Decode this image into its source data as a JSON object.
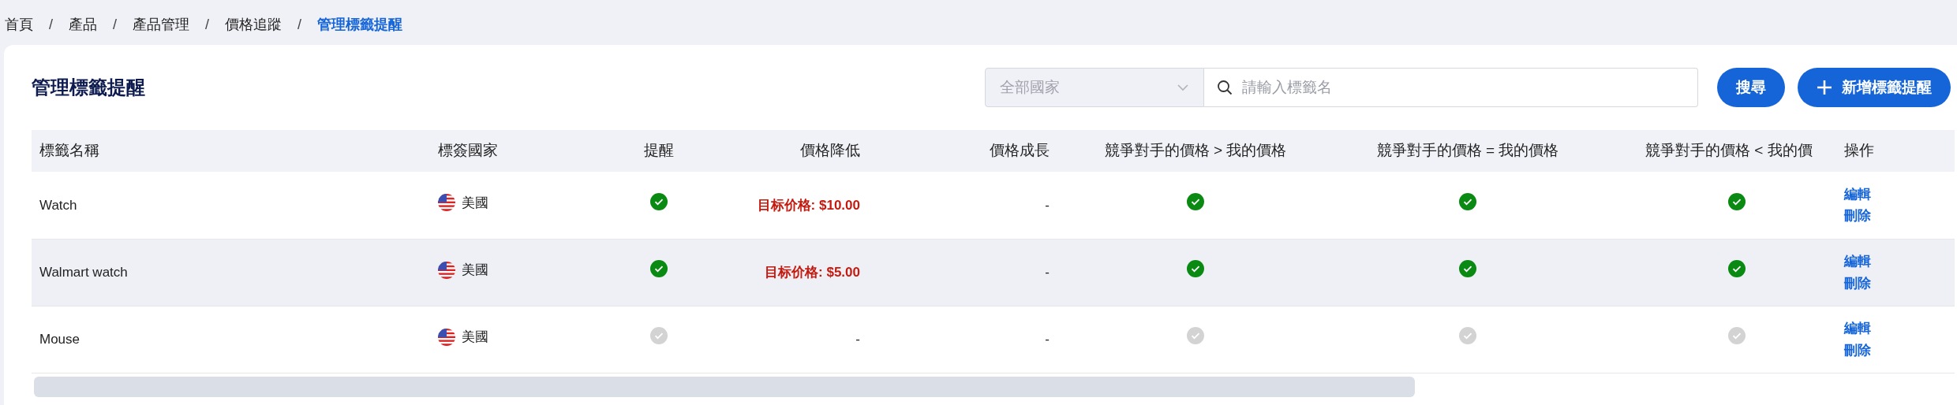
{
  "breadcrumb": [
    {
      "label": "首頁",
      "current": false
    },
    {
      "separator": "/",
      "label": "產品",
      "current": false
    },
    {
      "separator": "/",
      "label": "產品管理",
      "current": false
    },
    {
      "separator": "/",
      "label": "價格追蹤",
      "current": false
    },
    {
      "separator": "/",
      "label": "管理標籤提醒",
      "current": true
    }
  ],
  "title": "管理標籤提醒",
  "country_select": {
    "value": "全部國家"
  },
  "search": {
    "placeholder": "請輸入標籤名"
  },
  "buttons": [
    {
      "label": "搜尋",
      "kind": "search"
    },
    {
      "label": "新增標籤提醒",
      "kind": "add"
    }
  ],
  "table": {
    "columns": [
      "標籤名稱",
      "標簽國家",
      "提醒",
      "價格降低",
      "價格成長",
      "競爭對手的價格 > 我的價格",
      "競爭對手的價格 = 我的價格",
      "競爭對手的價格 < 我的價",
      "操作"
    ],
    "rows": [
      {
        "name": "Watch",
        "country": "美國",
        "hovered": false,
        "remind": true,
        "price_drop": "目标价格: $10.00",
        "price_growth": "-",
        "competitor_higher": true,
        "competitor_equal": true,
        "competitor_lower": true,
        "actions": [
          "編輯",
          "刪除"
        ]
      },
      {
        "name": "Walmart watch",
        "country": "美國",
        "hovered": true,
        "remind": true,
        "price_drop": "目标价格: $5.00",
        "price_growth": "-",
        "competitor_higher": true,
        "competitor_equal": true,
        "competitor_lower": true,
        "actions": [
          "編輯",
          "刪除"
        ]
      },
      {
        "name": "Mouse",
        "country": "美國",
        "hovered": false,
        "remind": false,
        "price_drop": "-",
        "price_growth": "-",
        "competitor_higher": false,
        "competitor_equal": false,
        "competitor_lower": false,
        "actions": [
          "編輯",
          "刪除"
        ]
      }
    ]
  }
}
